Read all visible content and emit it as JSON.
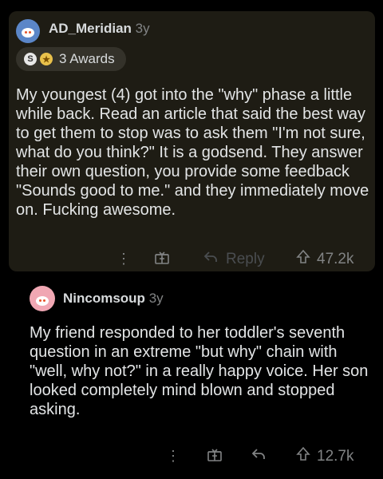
{
  "comment1": {
    "username": "AD_Meridian",
    "age": "3y",
    "awards_label": "3 Awards",
    "body": "My youngest (4) got into the \"why\" phase a little while back.  Read an article that said the best way to get them to stop was to ask them \"I'm not sure, what do you think?\"   It is a godsend. They answer their own question, you provide some feedback \"Sounds good to me.\" and they immediately move on.  Fucking awesome.",
    "reply_label": "Reply",
    "upvotes": "47.2k"
  },
  "comment2": {
    "username": "Nincomsoup",
    "age": "3y",
    "body": "My friend responded to her toddler's seventh question in an extreme \"but why\" chain with \"well, why not?\" in a really happy voice. Her son looked completely mind blown and stopped asking.",
    "upvotes": "12.7k"
  },
  "icons": [
    "snoo-avatar-icon",
    "silver-award-icon",
    "gold-award-icon",
    "more-options-icon",
    "award-gift-icon",
    "reply-arrow-icon",
    "upvote-icon"
  ],
  "colors": {
    "background": "#000000",
    "highlight_card": "#1e1c14",
    "muted_text": "#818384",
    "avatar1": "#5b86c8",
    "avatar2": "#f0a7b3"
  }
}
